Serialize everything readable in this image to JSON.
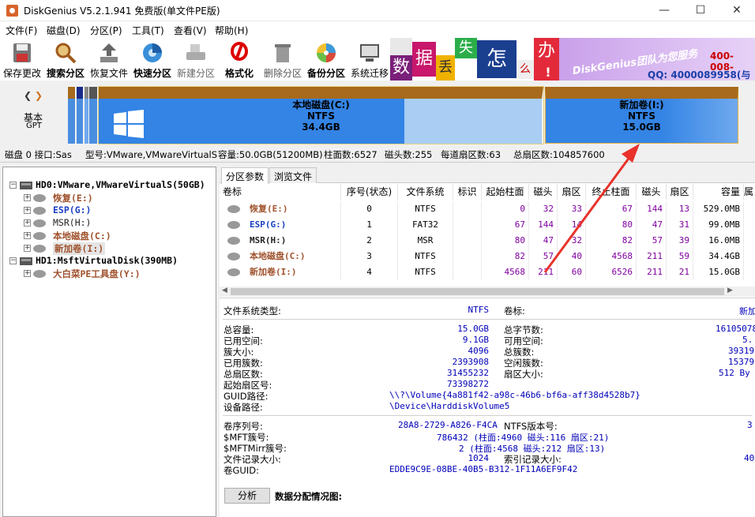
{
  "window": {
    "title": "DiskGenius V5.2.1.941 免费版(单文件PE版)",
    "min": "—",
    "max": "☐",
    "close": "✕"
  },
  "menu": [
    "文件(F)",
    "磁盘(D)",
    "分区(P)",
    "工具(T)",
    "查看(V)",
    "帮助(H)"
  ],
  "toolbar": [
    {
      "label": "保存更改",
      "icon": "save-icon"
    },
    {
      "label": "搜索分区",
      "icon": "magnifier-icon"
    },
    {
      "label": "恢复文件",
      "icon": "recover-icon"
    },
    {
      "label": "快速分区",
      "icon": "quick-partition-icon"
    },
    {
      "label": "新建分区",
      "icon": "new-partition-icon"
    },
    {
      "label": "格式化",
      "icon": "format-icon"
    },
    {
      "label": "删除分区",
      "icon": "trash-icon"
    },
    {
      "label": "备份分区",
      "icon": "backup-icon"
    },
    {
      "label": "系统迁移",
      "icon": "migrate-icon"
    }
  ],
  "banner": {
    "chars": [
      "数",
      "据",
      "丢",
      "失",
      "怎",
      "么",
      "办",
      "!"
    ],
    "slogan": "DiskGenius团队为您服务",
    "phone": "400-008-",
    "qq": "QQ: 4000089958(与电"
  },
  "diskmap": {
    "type_line1": "基本",
    "type_line2": "GPT",
    "partitions": [
      {
        "name": "本地磁盘(C:)",
        "fs": "NTFS",
        "size": "34.4GB"
      },
      {
        "name": "新加卷(I:)",
        "fs": "NTFS",
        "size": "15.0GB"
      }
    ]
  },
  "diskinfo": {
    "disk": "磁盘 0 接口:Sas",
    "model": "型号:VMware,VMwareVirtualS",
    "capacity": "容量:50.0GB(51200MB)",
    "cylinders": "柱面数:6527",
    "heads": "磁头数:255",
    "sectors_per_track": "每道扇区数:63",
    "total_sectors": "总扇区数:104857600"
  },
  "tree": {
    "hd0": "HD0:VMware,VMwareVirtualS(50GB)",
    "hd0_items": [
      "恢复(E:)",
      "ESP(G:)",
      "MSR(H:)",
      "本地磁盘(C:)",
      "新加卷(I:)"
    ],
    "hd1": "HD1:MsftVirtualDisk(390MB)",
    "hd1_items": [
      "大白菜PE工具盘(Y:)"
    ],
    "colors": {
      "brown": "#a0522d",
      "blue": "#1a3fc4",
      "black": "#222222"
    }
  },
  "tabs": [
    "分区参数",
    "浏览文件"
  ],
  "table": {
    "headers": [
      "卷标",
      "序号(状态)",
      "文件系统",
      "标识",
      "起始柱面",
      "磁头",
      "扇区",
      "终止柱面",
      "磁头",
      "扇区",
      "容量",
      "属"
    ],
    "rows": [
      [
        "恢复(E:)",
        "0",
        "NTFS",
        "",
        "0",
        "32",
        "33",
        "67",
        "144",
        "13",
        "529.0MB"
      ],
      [
        "ESP(G:)",
        "1",
        "FAT32",
        "",
        "67",
        "144",
        "14",
        "80",
        "47",
        "31",
        "99.0MB"
      ],
      [
        "MSR(H:)",
        "2",
        "MSR",
        "",
        "80",
        "47",
        "32",
        "82",
        "57",
        "39",
        "16.0MB"
      ],
      [
        "本地磁盘(C:)",
        "3",
        "NTFS",
        "",
        "82",
        "57",
        "40",
        "4568",
        "211",
        "59",
        "34.4GB"
      ],
      [
        "新加卷(I:)",
        "4",
        "NTFS",
        "",
        "4568",
        "211",
        "60",
        "6526",
        "211",
        "21",
        "15.0GB"
      ]
    ]
  },
  "details": {
    "fs_type_label": "文件系统类型:",
    "fs_type": "NTFS",
    "vol_label_label": "卷标:",
    "vol_label": "新加",
    "total_cap_label": "总容量:",
    "total_cap": "15.0GB",
    "total_bytes_label": "总字节数:",
    "total_bytes": "16105078",
    "used_label": "已用空间:",
    "used": "9.1GB",
    "free_label": "可用空间:",
    "free": "5.",
    "cluster_size_label": "簇大小:",
    "cluster_size": "4096",
    "total_clusters_label": "总簇数:",
    "total_clusters": "39319",
    "used_clusters_label": "已用簇数:",
    "used_clusters": "2393908",
    "free_clusters_label": "空闲簇数:",
    "free_clusters": "15379",
    "total_sectors_label": "总扇区数:",
    "total_sectors": "31455232",
    "sector_size_label": "扇区大小:",
    "sector_size": "512 By",
    "start_sector_label": "起始扇区号:",
    "start_sector": "73398272",
    "guid_path_label": "GUID路径:",
    "guid_path": "\\\\?\\Volume{4a881f42-a98c-46b6-bf6a-aff38d4528b7}",
    "device_path_label": "设备路径:",
    "device_path": "\\Device\\HarddiskVolume5",
    "serial_label": "卷序列号:",
    "serial": "28A8-2729-A826-F4CA",
    "ntfs_ver_label": "NTFS版本号:",
    "ntfs_ver": "3",
    "mft_label": "$MFT簇号:",
    "mft": "786432 (柱面:4960 磁头:116 扇区:21)",
    "mftmirr_label": "$MFTMirr簇号:",
    "mftmirr": "2 (柱面:4568 磁头:212 扇区:13)",
    "frs_label": "文件记录大小:",
    "frs": "1024",
    "index_label": "索引记录大小:",
    "index": "40",
    "guid_label": "卷GUID:",
    "guid": "EDDE9C9E-08BE-40B5-B312-1F11A6EF9F42",
    "analyze": "分析",
    "alloc_label": "数据分配情况图:"
  }
}
